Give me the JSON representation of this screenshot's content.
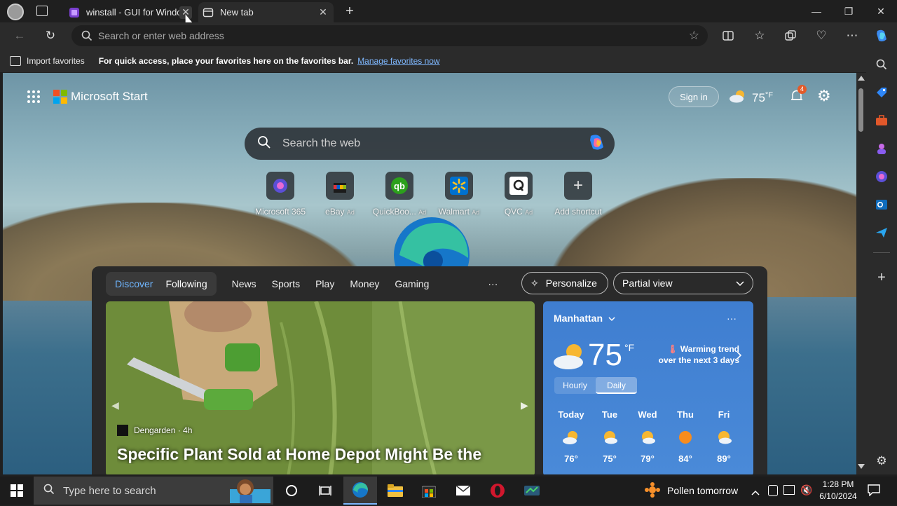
{
  "browser": {
    "tabs": [
      {
        "label": "winstall - GUI for Windo",
        "active": false
      },
      {
        "label": "New tab",
        "active": true
      }
    ],
    "address_placeholder": "Search or enter web address",
    "favorites_bar": {
      "import_label": "Import favorites",
      "hint": "For quick access, place your favorites here on the favorites bar.",
      "manage_link": "Manage favorites now"
    }
  },
  "newtab": {
    "brand": "Microsoft Start",
    "sign_in": "Sign in",
    "header_temp": "75",
    "header_unit": "°F",
    "notification_count": "4",
    "search_placeholder": "Search the web",
    "shortcuts": [
      {
        "label": "Microsoft 365",
        "ad": ""
      },
      {
        "label": "eBay",
        "ad": "Ad"
      },
      {
        "label": "QuickBoo...",
        "ad": "Ad"
      },
      {
        "label": "Walmart",
        "ad": "Ad"
      },
      {
        "label": "QVC",
        "ad": "Ad"
      },
      {
        "label": "Add shortcut",
        "ad": ""
      }
    ],
    "feed_tabs": [
      "Discover",
      "Following",
      "News",
      "Sports",
      "Play",
      "Money",
      "Gaming"
    ],
    "more": "···",
    "personalize": "Personalize",
    "view_mode": "Partial view",
    "hero": {
      "source": "Dengarden · 4h",
      "headline": "Specific Plant Sold at Home Depot Might Be the"
    },
    "weather": {
      "location": "Manhattan",
      "temp": "75",
      "unit": "°F",
      "trend_line1": "Warming trend",
      "trend_line2": "over the next 3 days",
      "toggle": [
        "Hourly",
        "Daily"
      ],
      "days": [
        {
          "name": "Today",
          "high": "76°",
          "icon": "sun-cloud"
        },
        {
          "name": "Tue",
          "high": "75°",
          "icon": "sun-cloud"
        },
        {
          "name": "Wed",
          "high": "79°",
          "icon": "sun-cloud"
        },
        {
          "name": "Thu",
          "high": "84°",
          "icon": "sun"
        },
        {
          "name": "Fri",
          "high": "89°",
          "icon": "sun-cloud"
        }
      ]
    }
  },
  "taskbar": {
    "search_placeholder": "Type here to search",
    "pollen": "Pollen tomorrow",
    "time": "1:28 PM",
    "date": "6/10/2024"
  }
}
